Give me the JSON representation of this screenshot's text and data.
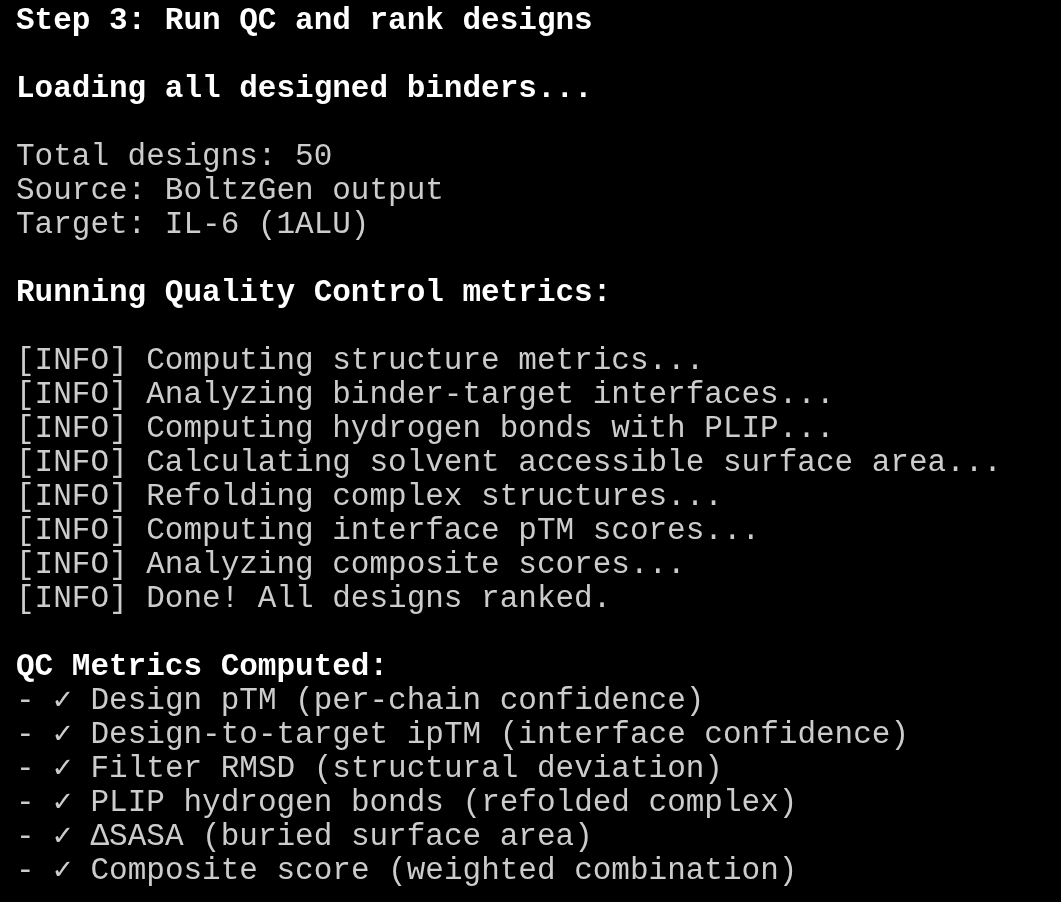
{
  "lines": [
    {
      "kind": "heading",
      "text": "Step 3: Run QC and rank designs"
    },
    {
      "kind": "blank"
    },
    {
      "kind": "heading",
      "text": "Loading all designed binders..."
    },
    {
      "kind": "blank"
    },
    {
      "kind": "output",
      "text": "Total designs: 50"
    },
    {
      "kind": "output",
      "text": "Source: BoltzGen output"
    },
    {
      "kind": "output",
      "text": "Target: IL-6 (1ALU)"
    },
    {
      "kind": "blank"
    },
    {
      "kind": "heading",
      "text": "Running Quality Control metrics:"
    },
    {
      "kind": "blank"
    },
    {
      "kind": "output",
      "text": "[INFO] Computing structure metrics..."
    },
    {
      "kind": "output",
      "text": "[INFO] Analyzing binder-target interfaces..."
    },
    {
      "kind": "output",
      "text": "[INFO] Computing hydrogen bonds with PLIP..."
    },
    {
      "kind": "output",
      "text": "[INFO] Calculating solvent accessible surface area..."
    },
    {
      "kind": "output",
      "text": "[INFO] Refolding complex structures..."
    },
    {
      "kind": "output",
      "text": "[INFO] Computing interface pTM scores..."
    },
    {
      "kind": "output",
      "text": "[INFO] Analyzing composite scores..."
    },
    {
      "kind": "output",
      "text": "[INFO] Done! All designs ranked."
    },
    {
      "kind": "blank"
    },
    {
      "kind": "heading",
      "text": "QC Metrics Computed:"
    },
    {
      "kind": "output",
      "text": "- ✓ Design pTM (per-chain confidence)"
    },
    {
      "kind": "output",
      "text": "- ✓ Design-to-target ipTM (interface confidence)"
    },
    {
      "kind": "output",
      "text": "- ✓ Filter RMSD (structural deviation)"
    },
    {
      "kind": "output",
      "text": "- ✓ PLIP hydrogen bonds (refolded complex)"
    },
    {
      "kind": "output",
      "text": "- ✓ ΔSASA (buried surface area)"
    },
    {
      "kind": "output",
      "text": "- ✓ Composite score (weighted combination)"
    }
  ]
}
